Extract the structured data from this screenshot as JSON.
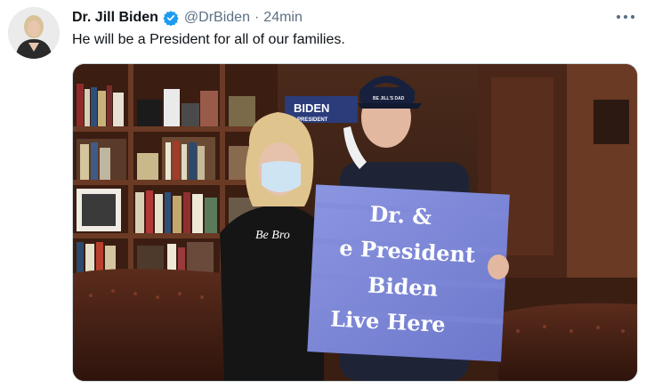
{
  "tweet": {
    "display_name": "Dr. Jill Biden",
    "handle": "@DrBiden",
    "separator": "·",
    "timestamp": "24min",
    "text": "He will be a President for all of our families.",
    "verified_icon": "verified-badge-icon",
    "more_icon": "more-options-icon"
  },
  "photo": {
    "sign_lines": [
      "Dr. &",
      "e President",
      "Biden",
      "Live Here"
    ],
    "shirt_text": "Be Bro",
    "cap_text": "BE JILL'S DAD",
    "banner_text": "BIDEN",
    "banner_subtext": "PRESIDENT"
  },
  "colors": {
    "name": "#0f1419",
    "secondary": "#5b7083",
    "verified": "#1d9bf0",
    "sign": "#7c86d6"
  }
}
